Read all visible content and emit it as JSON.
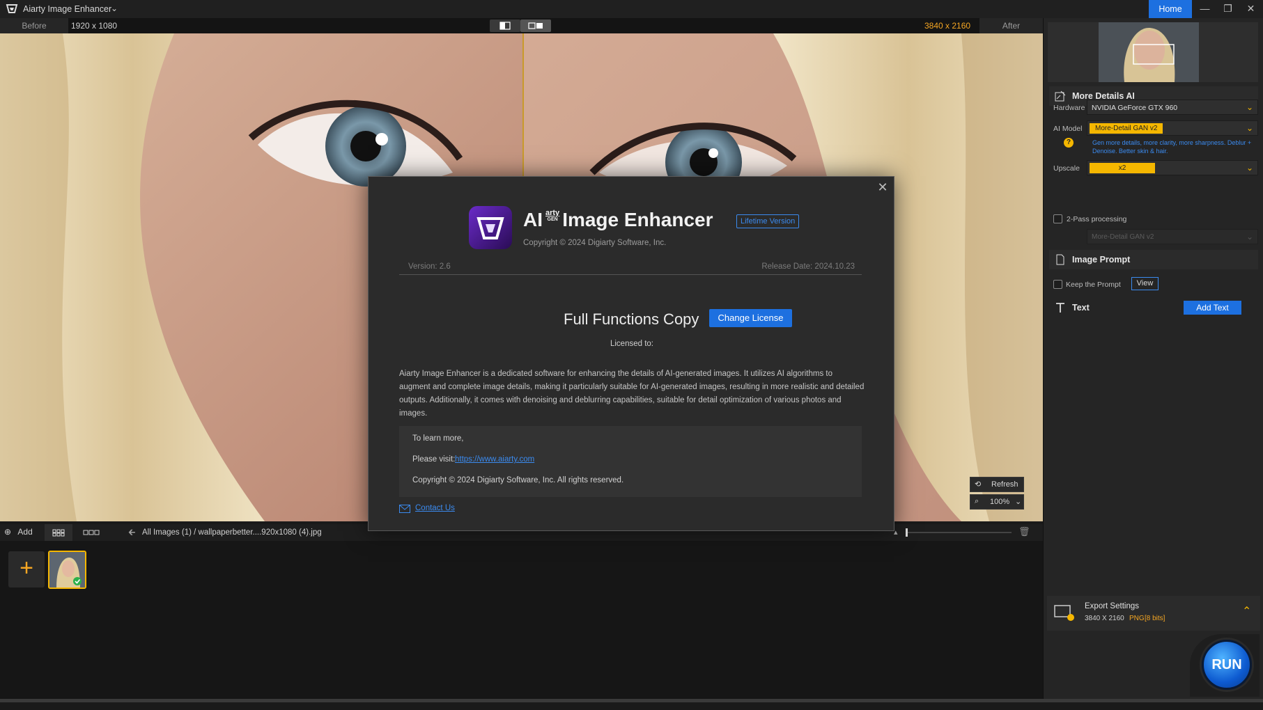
{
  "app": {
    "title": "Aiarty Image Enhancer",
    "home": "Home"
  },
  "compare": {
    "before": "Before",
    "before_res": "1920 x 1080",
    "after_res": "3840 x 2160",
    "after": "After"
  },
  "bottom": {
    "add": "Add",
    "breadcrumb": "All Images (1)  /   wallpaperbetter....920x1080 (4).jpg",
    "refresh": "Refresh",
    "zoom": "100%"
  },
  "panel": {
    "section_title": "More Details AI",
    "hardware_label": "Hardware",
    "hardware_value": "NVIDIA GeForce GTX 960",
    "model_label": "AI Model",
    "model_value": "More-Detail GAN v2",
    "model_desc": "Gen more details, more clarity, more sharpness. Deblur + Denoise. Better skin & hair.",
    "upscale_label": "Upscale",
    "upscale_value": "x2",
    "twopass_label": "2-Pass processing",
    "twopass_model": "More-Detail GAN v2",
    "prompt_title": "Image Prompt",
    "keep_prompt": "Keep the Prompt",
    "view": "View",
    "text_title": "Text",
    "add_text": "Add Text",
    "export_title": "Export Settings",
    "export_res": "3840 X 2160",
    "export_fmt": "PNG",
    "export_bits": "[8 bits]",
    "run": "RUN"
  },
  "modal": {
    "title_ai": "AI",
    "title_arty": "arty",
    "title_gen": "GEN",
    "title_main": "Image Enhancer",
    "badge": "Lifetime Version",
    "copyright": "Copyright © 2024 Digiarty Software, Inc.",
    "version": "Version: 2.6",
    "release": "Release Date: 2024.10.23",
    "full_copy": "Full Functions Copy",
    "change_license": "Change License",
    "licensed_to": "Licensed to:",
    "description": "Aiarty Image Enhancer is a dedicated software for enhancing the details of AI-generated images. It utilizes AI algorithms to augment and complete image details, making it particularly suitable for AI-generated images, resulting in more realistic and detailed outputs. Additionally, it comes with denoising and deblurring capabilities, suitable for detail optimization of various photos and images.",
    "learn_more": "To learn more,",
    "visit_label": "Please visit:",
    "visit_link": "https://www.aiarty.com",
    "copyright_full": "Copyright © 2024 Digiarty Software, Inc. All rights reserved.",
    "contact": "Contact Us"
  },
  "colors": {
    "accent": "#1d70e0",
    "highlight": "#f5b700",
    "orange_text": "#f5a623"
  }
}
